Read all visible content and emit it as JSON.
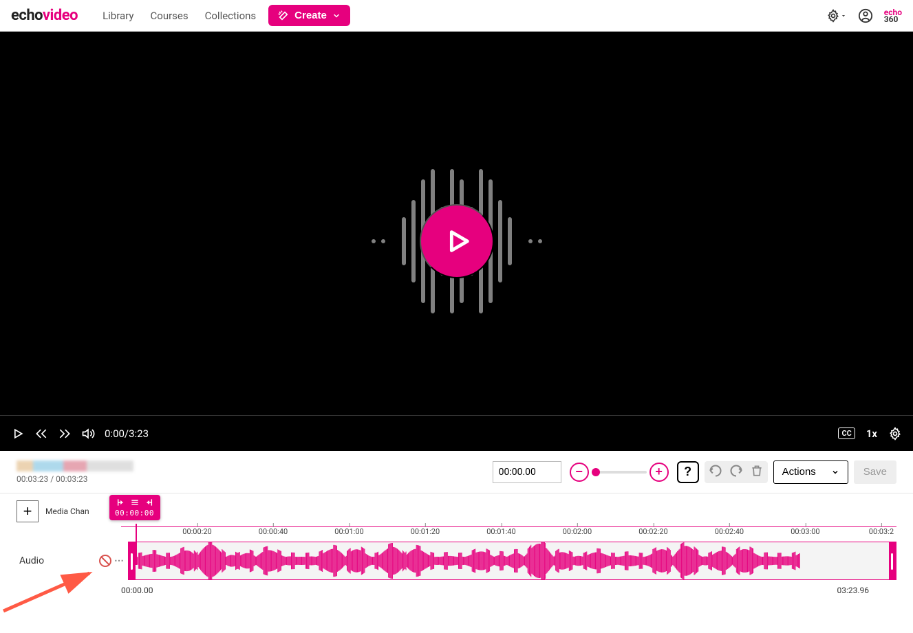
{
  "header": {
    "logo": {
      "part1": "echo",
      "part2": "video"
    },
    "nav": [
      "Library",
      "Courses",
      "Collections"
    ],
    "create": "Create",
    "echo360": {
      "top": "echo",
      "bottom": "360"
    }
  },
  "player": {
    "timeDisplay": "0:00/3:23",
    "cc": "CC",
    "speed": "1x"
  },
  "editor": {
    "titleTimes": "00:03:23 / 00:03:23",
    "timecode": "00:00.00",
    "actions": "Actions",
    "save": "Save",
    "help": "?"
  },
  "timeline": {
    "mediaChannelsLabel": "Media Chan",
    "playheadTime": "00:00:00",
    "ruler": [
      "00:00:20",
      "00:00:40",
      "00:01:00",
      "00:01:20",
      "00:01:40",
      "00:02:00",
      "00:02:20",
      "00:02:40",
      "00:03:00",
      "00:03:2"
    ],
    "trackLabel": "Audio",
    "start": "00:00.00",
    "end": "03:23.96"
  }
}
